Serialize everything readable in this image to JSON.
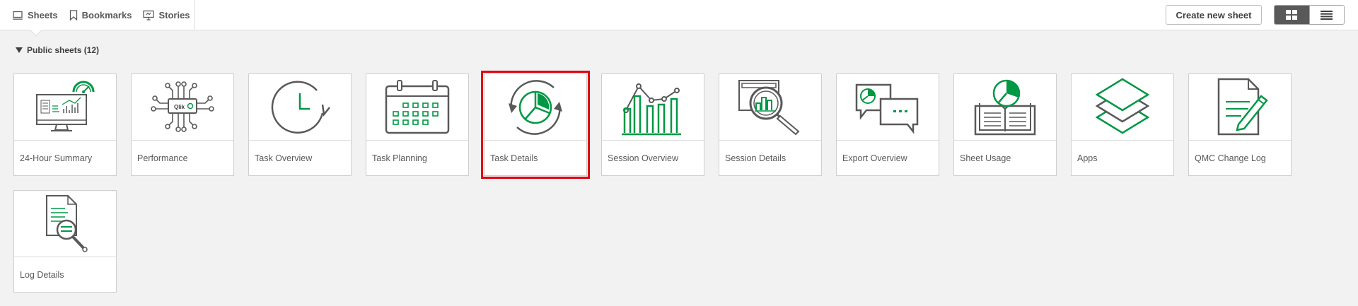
{
  "nav": {
    "sheets": "Sheets",
    "bookmarks": "Bookmarks",
    "stories": "Stories"
  },
  "toolbar": {
    "create_label": "Create new sheet"
  },
  "section": {
    "title": "Public sheets (12)"
  },
  "sheets": [
    {
      "title": "24-Hour Summary",
      "icon": "dashboard-monitor-icon"
    },
    {
      "title": "Performance",
      "icon": "circuit-chip-icon"
    },
    {
      "title": "Task Overview",
      "icon": "clock-refresh-icon"
    },
    {
      "title": "Task Planning",
      "icon": "calendar-icon"
    },
    {
      "title": "Task Details",
      "icon": "pie-refresh-icon",
      "selected": true
    },
    {
      "title": "Session Overview",
      "icon": "bar-line-chart-icon"
    },
    {
      "title": "Session Details",
      "icon": "magnifier-report-icon"
    },
    {
      "title": "Export Overview",
      "icon": "chat-bubbles-icon"
    },
    {
      "title": "Sheet Usage",
      "icon": "open-book-icon"
    },
    {
      "title": "Apps",
      "icon": "layers-icon"
    },
    {
      "title": "QMC Change Log",
      "icon": "document-pencil-icon"
    },
    {
      "title": "Log Details",
      "icon": "document-search-icon"
    }
  ],
  "colors": {
    "accent_green": "#009845",
    "icon_gray": "#595959",
    "selection_red": "#e0000e",
    "background": "#f2f2f2"
  }
}
